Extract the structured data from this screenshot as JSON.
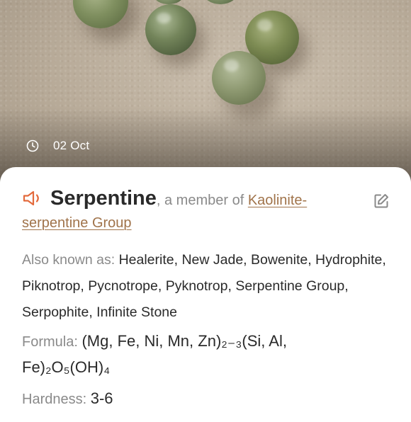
{
  "photo": {
    "date": "02 Oct",
    "icon": "clock-icon"
  },
  "mineral": {
    "name": "Serpentine",
    "member_of_text": ", a member of ",
    "group_link": "Kaolinite-serpentine Group",
    "speaker_icon": "speaker-icon",
    "edit_icon": "edit-icon",
    "accent_color": "#a0734a"
  },
  "details": {
    "aka_label": "Also known as:",
    "aka_value": "Healerite, New Jade, Bowenite, Hydrophite, Piknotrop, Pycnotrope, Pyknotrop, Serpentine Group, Serpophite, Infinite Stone",
    "formula_label": "Formula:",
    "formula_value": "(Mg, Fe, Ni, Mn, Zn)₂₋₃(Si, Al, Fe)₂O₅(OH)₄",
    "hardness_label": "Hardness:",
    "hardness_value": "3-6"
  }
}
